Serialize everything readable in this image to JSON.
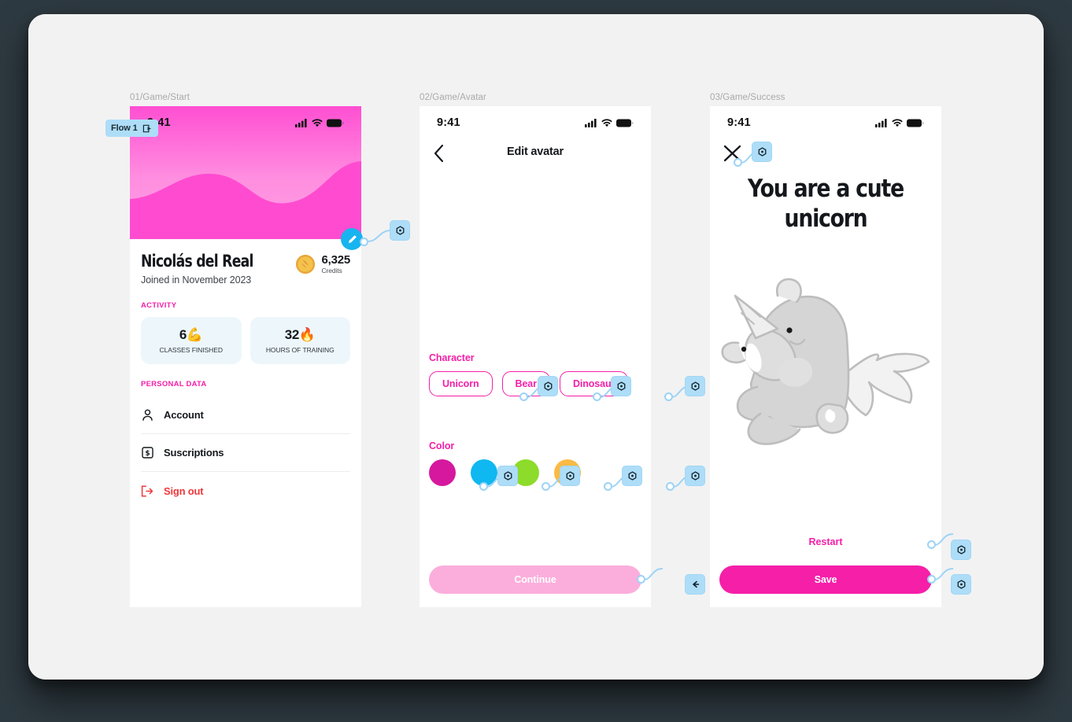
{
  "app": {
    "background_color": "#2e3a41",
    "canvas_color": "#f2f2f2",
    "accent_pink": "#F51FA8",
    "proto_blue": "#AEDDF8",
    "flow_badge": {
      "label": "Flow 1",
      "icon": "flow-start-icon"
    }
  },
  "frames": [
    {
      "name": "01/Game/Start"
    },
    {
      "name": "02/Game/Avatar"
    },
    {
      "name": "03/Game/Success"
    }
  ],
  "status_bar": {
    "time": "9:41",
    "icons": [
      "cellular-signal-icon",
      "wifi-icon",
      "battery-icon"
    ]
  },
  "screen1": {
    "profile": {
      "name": "Nicolás del Real",
      "joined": "Joined in November 2023",
      "credits_value": "6,325",
      "credits_label": "Credits",
      "credits_icon": "coin-icon",
      "edit_avatar_icon": "pencil-icon"
    },
    "activity": {
      "section_label": "ACTIVITY",
      "stats": [
        {
          "value": "6",
          "emoji": "💪",
          "label": "CLASSES FINISHED"
        },
        {
          "value": "32",
          "emoji": "🔥",
          "label": "HOURS OF TRAINING"
        }
      ]
    },
    "personal_data": {
      "section_label": "PERSONAL DATA",
      "rows": [
        {
          "label": "Account",
          "icon": "person-icon",
          "danger": false
        },
        {
          "label": "Suscriptions",
          "icon": "dollar-box-icon",
          "danger": false
        },
        {
          "label": "Sign out",
          "icon": "sign-out-icon",
          "danger": true
        }
      ]
    }
  },
  "screen2": {
    "nav": {
      "title": "Edit avatar",
      "back_icon": "chevron-left-icon"
    },
    "character": {
      "label": "Character",
      "options": [
        "Unicorn",
        "Bear",
        "Dinosaur"
      ]
    },
    "color": {
      "label": "Color",
      "options": [
        {
          "name": "magenta",
          "hex": "#D6189E"
        },
        {
          "name": "cyan",
          "hex": "#0FB8F0"
        },
        {
          "name": "green",
          "hex": "#8DDB2A"
        },
        {
          "name": "orange",
          "hex": "#FBBA44"
        }
      ]
    },
    "continue_button": {
      "label": "Continue",
      "color": "#FBAEDC"
    }
  },
  "screen3": {
    "close_icon": "close-x-icon",
    "title": "You are a cute unicorn",
    "illustration": "unicorn-illustration",
    "restart_link": "Restart",
    "save_button": {
      "label": "Save",
      "color": "#F51FA8"
    }
  },
  "prototype": {
    "node_icon": "prototype-interaction-icon",
    "branch_icon": "prototype-multiple-connections-icon"
  }
}
